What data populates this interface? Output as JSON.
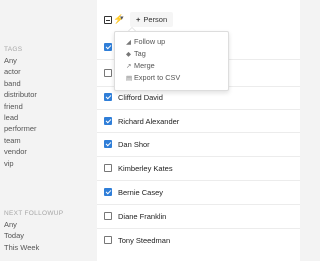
{
  "sidebar": {
    "tags_title": "TAGS",
    "tags": [
      "Any",
      "actor",
      "band",
      "distributor",
      "friend",
      "lead",
      "performer",
      "team",
      "vendor",
      "vip"
    ],
    "followup_title": "NEXT FOLLOWUP",
    "followup": [
      "Any",
      "Today",
      "This Week"
    ]
  },
  "toolbar": {
    "bolt_icon": "⚡",
    "caret_icon": "▾",
    "person_button": "Person",
    "plus_icon": "+"
  },
  "menu": {
    "items": [
      {
        "label": "Follow up",
        "icon": "follow-up-icon",
        "glyph": "◢"
      },
      {
        "label": "Tag",
        "icon": "tag-icon",
        "glyph": "◆"
      },
      {
        "label": "Merge",
        "icon": "merge-icon",
        "glyph": "↗"
      },
      {
        "label": "Export to CSV",
        "icon": "export-icon",
        "glyph": "▤"
      }
    ]
  },
  "contacts": [
    {
      "name": "",
      "checked": true
    },
    {
      "name": "",
      "checked": false
    },
    {
      "name": "Clifford David",
      "checked": true
    },
    {
      "name": "Richard Alexander",
      "checked": true
    },
    {
      "name": "Dan Shor",
      "checked": true
    },
    {
      "name": "Kimberley Kates",
      "checked": false
    },
    {
      "name": "Bernie Casey",
      "checked": true
    },
    {
      "name": "Diane Franklin",
      "checked": false
    },
    {
      "name": "Tony Steedman",
      "checked": false
    }
  ],
  "colors": {
    "accent": "#2f7ed8",
    "sidebar_bg": "#f3f3f3",
    "main_bg": "#ffffff"
  }
}
